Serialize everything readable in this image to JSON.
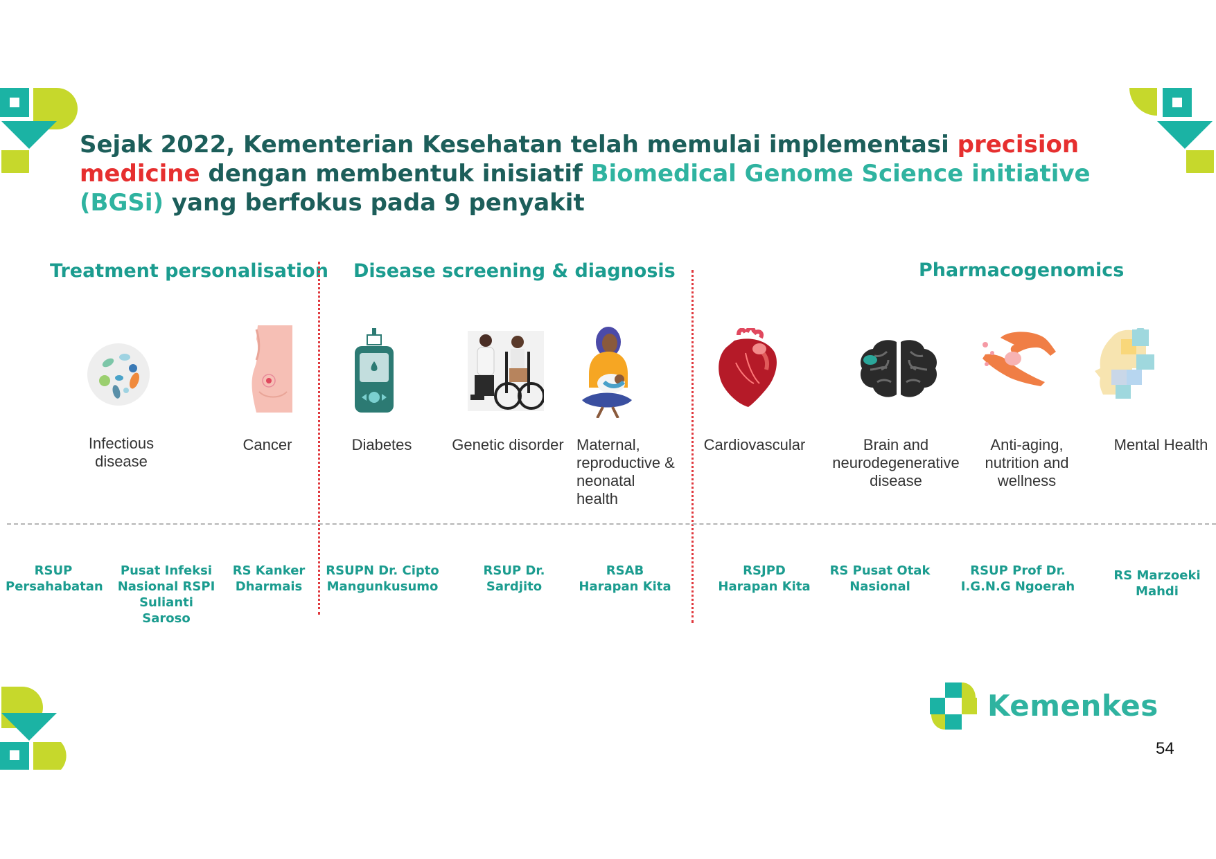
{
  "title": {
    "part1": "Sejak 2022, Kementerian Kesehatan telah memulai implementasi ",
    "highlight_red": "precision medicine",
    "part2": " dengan membentuk inisiatif ",
    "highlight_teal": "Biomedical Genome Science initiative (BGSi)",
    "part3": " yang berfokus pada 9 penyakit"
  },
  "categories": [
    "Treatment personalisation",
    "Disease screening & diagnosis",
    "Pharmacogenomics"
  ],
  "diseases": [
    {
      "label": "Infectious disease",
      "icon": "bacteria-icon"
    },
    {
      "label": "Cancer",
      "icon": "breast-cancer-icon"
    },
    {
      "label": "Diabetes",
      "icon": "glucose-meter-icon"
    },
    {
      "label": "Genetic disorder",
      "icon": "wheelchair-patient-icon"
    },
    {
      "label": "Maternal, reproductive & neonatal health",
      "icon": "mother-baby-icon"
    },
    {
      "label": "Cardiovascular",
      "icon": "heart-icon"
    },
    {
      "label": "Brain and neurodegenerative disease",
      "icon": "brain-icon"
    },
    {
      "label": "Anti-aging, nutrition and wellness",
      "icon": "hand-pill-icon"
    },
    {
      "label": "Mental Health",
      "icon": "puzzle-head-icon"
    }
  ],
  "hospitals": [
    "RSUP Persahabatan",
    "Pusat Infeksi Nasional RSPI Sulianti Saroso",
    "RS Kanker Dharmais",
    "RSUPN Dr. Cipto Mangunkusumo",
    "RSUP Dr. Sardjito",
    "RSAB Harapan Kita",
    "RSJPD Harapan Kita",
    "RS Pusat Otak Nasional",
    "RSUP Prof Dr. I.G.N.G Ngoerah",
    "RS Marzoeki Mahdi"
  ],
  "brand": "Kemenkes",
  "page_number": "54",
  "colors": {
    "title_dark": "#1c5e5a",
    "accent_red": "#e62f2f",
    "accent_teal": "#2fb3a0",
    "logo_lime": "#c6d82c",
    "divider_red": "#e0393e"
  }
}
